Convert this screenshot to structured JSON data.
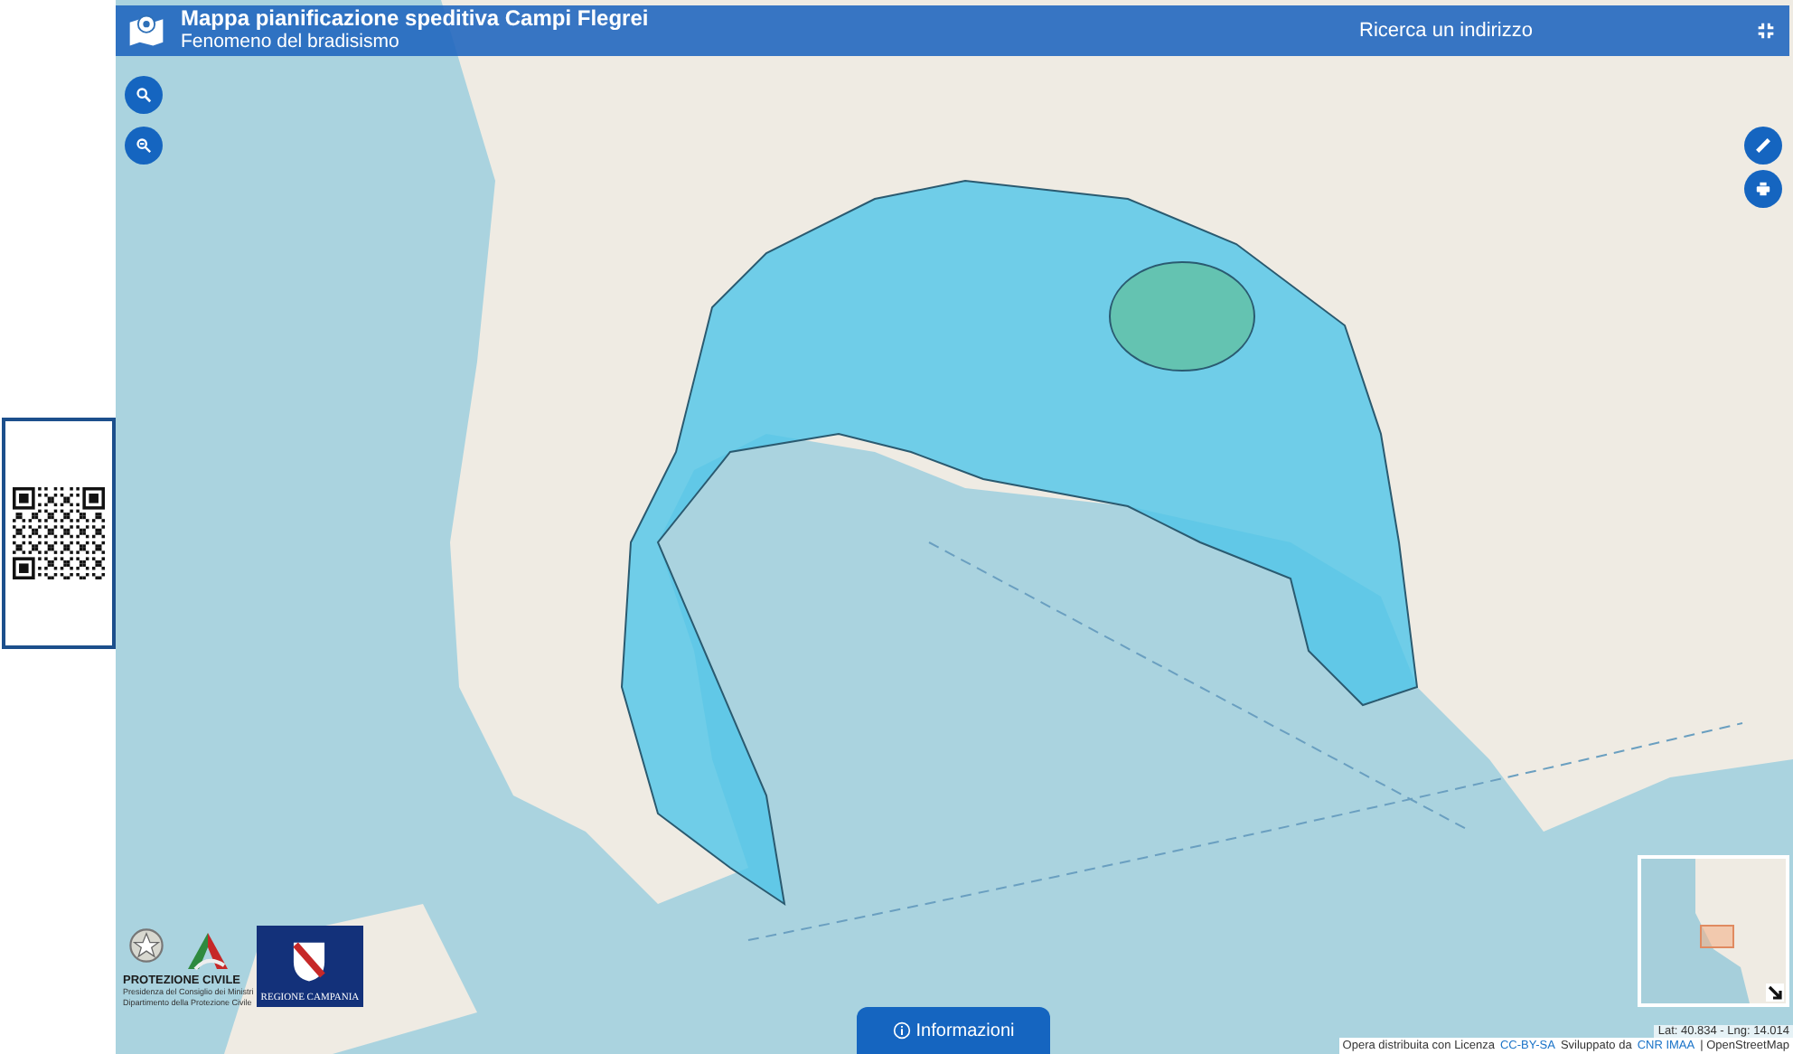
{
  "header": {
    "title": "Mappa pianificazione speditiva Campi Flegrei",
    "subtitle": "Fenomeno del bradisismo",
    "search": {
      "placeholder": "Ricerca un indirizzo"
    }
  },
  "logos": {
    "protezione_civile": {
      "title": "PROTEZIONE CIVILE",
      "lines": [
        "Presidenza del Consiglio dei Ministri",
        "Dipartimento della Protezione Civile"
      ]
    },
    "regione": "REGIONE CAMPANIA"
  },
  "info_button": {
    "label": "Informazioni"
  },
  "coordinates": "Lat: 40.834 - Lng: 14.014",
  "attribution": [
    {
      "kind": "text",
      "text": "Opera distribuita con Licenza"
    },
    {
      "kind": "link",
      "text": "CC-BY-SA"
    },
    {
      "kind": "text",
      "text": "Sviluppato da"
    },
    {
      "kind": "link",
      "text": "CNR IMAA"
    },
    {
      "kind": "text",
      "text": "| OpenStreetMap"
    }
  ]
}
